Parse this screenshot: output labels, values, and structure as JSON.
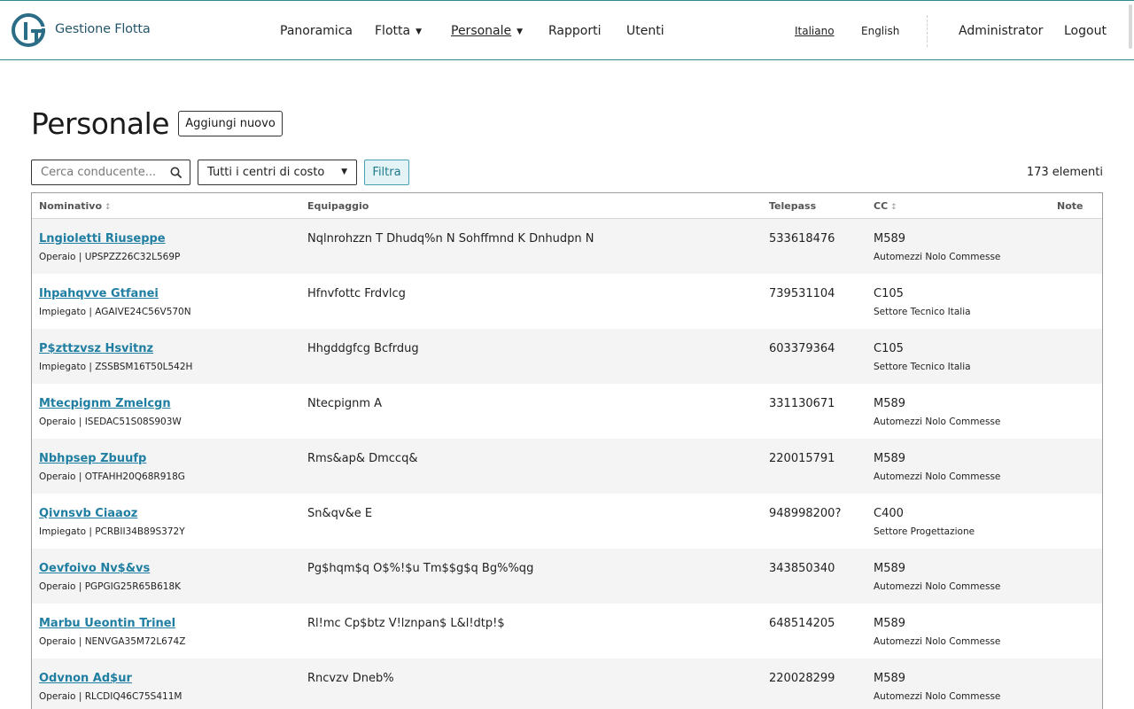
{
  "brand": "Gestione Flotta",
  "nav": [
    {
      "label": "Panoramica",
      "dropdown": false,
      "active": false
    },
    {
      "label": "Flotta",
      "dropdown": true,
      "active": false
    },
    {
      "label": "Personale",
      "dropdown": true,
      "active": true
    },
    {
      "label": "Rapporti",
      "dropdown": false,
      "active": false
    },
    {
      "label": "Utenti",
      "dropdown": false,
      "active": false
    }
  ],
  "languages": [
    {
      "label": "Italiano",
      "active": true
    },
    {
      "label": "English",
      "active": false
    }
  ],
  "user": "Administrator",
  "logout": "Logout",
  "page": {
    "title": "Personale",
    "add_label": "Aggiungi nuovo"
  },
  "filters": {
    "search_placeholder": "Cerca conducente...",
    "cost_center": "Tutti i centri di costo",
    "filter_label": "Filtra",
    "count": "173 elementi"
  },
  "columns": {
    "name": "Nominativo",
    "crew": "Equipaggio",
    "telepass": "Telepass",
    "cc": "CC",
    "notes": "Note"
  },
  "rows": [
    {
      "name": "Lngioletti Riuseppe",
      "role": "Operaio | UPSPZZ26C32L569P",
      "crew": "Nqlnrohzzn T Dhudq%n N Sohffmnd K Dnhudpn N",
      "telepass": "533618476",
      "cc": "M589",
      "cc_name": "Automezzi Nolo Commesse"
    },
    {
      "name": "Ihpahqvve Gtfanei",
      "role": "Impiegato | AGAIVE24C56V570N",
      "crew": "Hfnvfottc Frdvlcg",
      "telepass": "739531104",
      "cc": "C105",
      "cc_name": "Settore Tecnico Italia"
    },
    {
      "name": "P$zttzvsz Hsvitnz",
      "role": "Impiegato | ZSSBSM16T50L542H",
      "crew": "Hhgddgfcg Bcfrdug",
      "telepass": "603379364",
      "cc": "C105",
      "cc_name": "Settore Tecnico Italia"
    },
    {
      "name": "Mtecpignm Zmelcgn",
      "role": "Operaio | ISEDAC51S08S903W",
      "crew": "Ntecpignm A",
      "telepass": "331130671",
      "cc": "M589",
      "cc_name": "Automezzi Nolo Commesse"
    },
    {
      "name": "Nbhpsep Zbuufp",
      "role": "Operaio | OTFAHH20Q68R918G",
      "crew": "Rms&ap& Dmccq&",
      "telepass": "220015791",
      "cc": "M589",
      "cc_name": "Automezzi Nolo Commesse"
    },
    {
      "name": "Qivnsvb Ciaaoz",
      "role": "Impiegato | PCRBII34B89S372Y",
      "crew": "Sn&qv&e E",
      "telepass": "948998200?",
      "cc": "C400",
      "cc_name": "Settore Progettazione"
    },
    {
      "name": "Oevfoivo Nv$&vs",
      "role": "Operaio | PGPGIG25R65B618K",
      "crew": "Pg$hqm$q O$%!$u Tm$$g$q Bg%%qg",
      "telepass": "343850340",
      "cc": "M589",
      "cc_name": "Automezzi Nolo Commesse"
    },
    {
      "name": "Marbu Ueontin Trinel",
      "role": "Operaio | NENVGA35M72L674Z",
      "crew": "Rl!mc Cp$btz V!lznpan$ L&l!dtp!$",
      "telepass": "648514205",
      "cc": "M589",
      "cc_name": "Automezzi Nolo Commesse"
    },
    {
      "name": "Odvnon Ad$ur",
      "role": "Operaio | RLCDIQ46C75S411M",
      "crew": "Rncvzv Dneb%",
      "telepass": "220028299",
      "cc": "M589",
      "cc_name": "Automezzi Nolo Commesse"
    }
  ]
}
